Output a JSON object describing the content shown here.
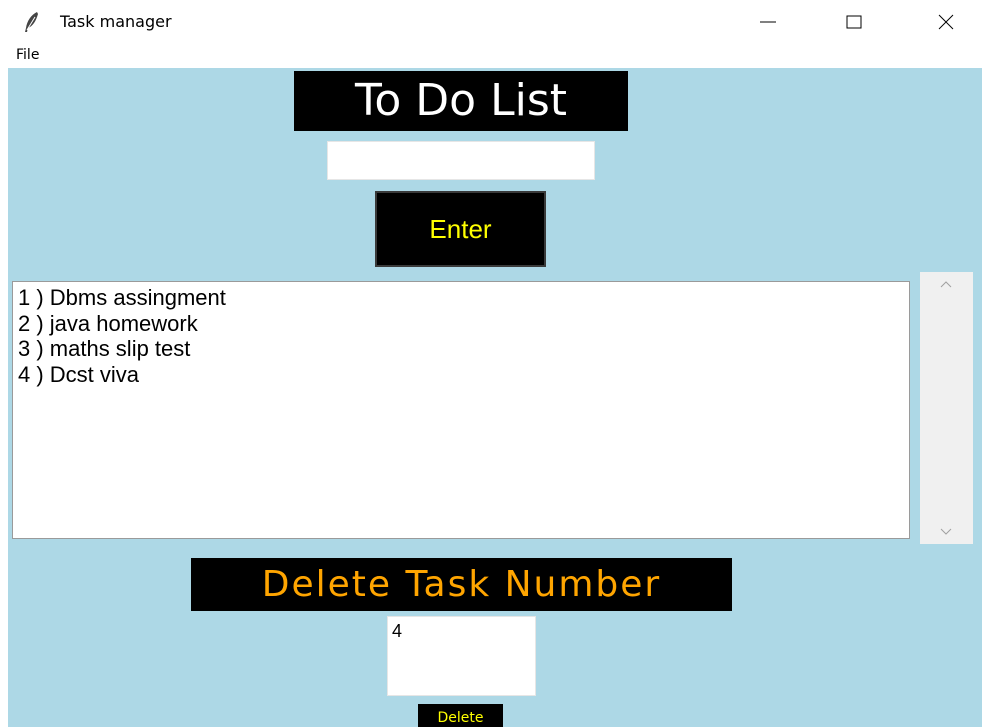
{
  "window": {
    "title": "Task manager",
    "icon": "feather-icon",
    "controls": [
      "minimize-icon",
      "maximize-icon",
      "close-icon"
    ]
  },
  "menubar": {
    "items": [
      {
        "label": "File"
      }
    ]
  },
  "app": {
    "heading": "To Do List",
    "task_input_value": "",
    "enter_label": "Enter",
    "tasks": [
      "1 ) Dbms assingment",
      "2 ) java homework",
      "3 ) maths slip test",
      "4 ) Dcst viva"
    ],
    "delete_heading": "Delete Task Number",
    "delete_input_value": "4",
    "delete_label": "Delete"
  },
  "colors": {
    "background": "#add8e6",
    "heading_bg": "#000000",
    "heading_text": "#ffffff",
    "enter_text": "#ffff00",
    "delete_heading_text": "#ffa500",
    "delete_button_text": "#ffff00"
  }
}
